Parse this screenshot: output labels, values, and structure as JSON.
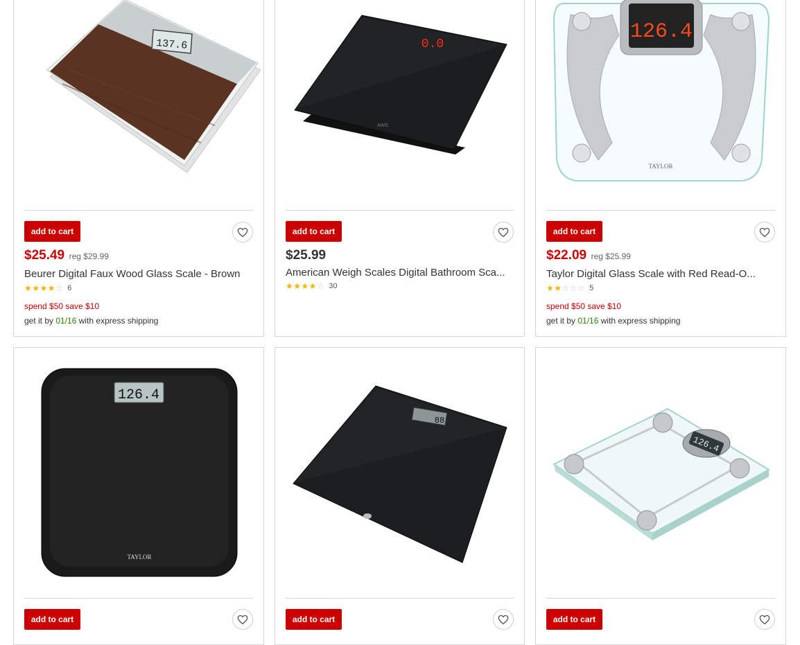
{
  "cards": [
    {
      "add_to_cart": "add to cart",
      "price": "$25.49",
      "reg": "reg $29.99",
      "title": "Beurer Digital Faux Wood Glass Scale - Brown",
      "stars": 4,
      "rating_count": "6",
      "promo": "spend $50 save $10",
      "ship_prefix": "get it by",
      "ship_date": "01/16",
      "ship_suffix": "with express shipping",
      "display": "137.6"
    },
    {
      "add_to_cart": "add to cart",
      "price": "$25.99",
      "title": "American Weigh Scales Digital Bathroom Sca...",
      "stars": 4,
      "rating_count": "30",
      "display": "0.0",
      "brand": "AWS"
    },
    {
      "add_to_cart": "add to cart",
      "price": "$22.09",
      "reg": "reg $25.99",
      "title": "Taylor Digital Glass Scale with Red Read-O...",
      "stars": 2,
      "rating_count": "5",
      "promo": "spend $50 save $10",
      "ship_prefix": "get it by",
      "ship_date": "01/16",
      "ship_suffix": "with express shipping",
      "display": "126.4",
      "brand": "TAYLOR"
    },
    {
      "add_to_cart": "add to cart",
      "display": "126.4",
      "brand": "TAYLOR"
    },
    {
      "add_to_cart": "add to cart",
      "display": "88"
    },
    {
      "add_to_cart": "add to cart",
      "display": "126.4"
    }
  ],
  "colors": {
    "brand_red": "#cc0000",
    "ship_green": "#2a8703",
    "star_gold": "#f5b400"
  },
  "icons": {
    "wishlist": "heart-icon",
    "rating": "star-icon"
  }
}
